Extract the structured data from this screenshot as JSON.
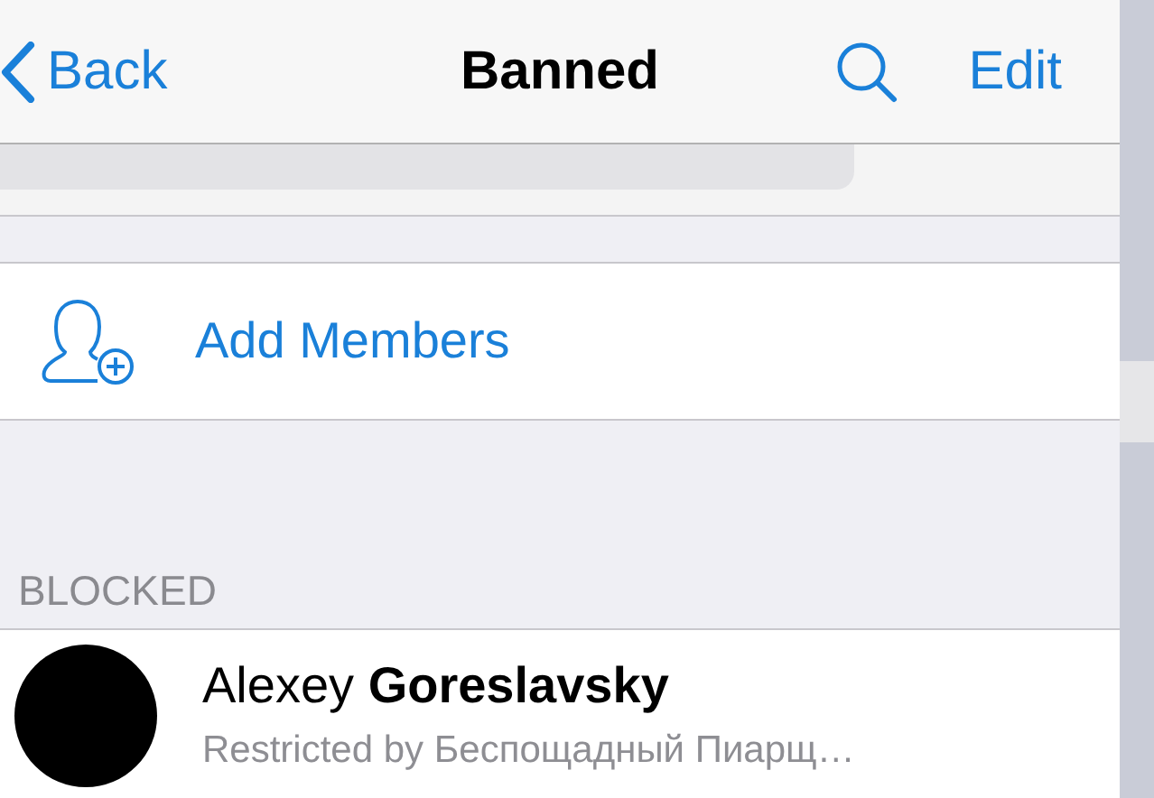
{
  "nav": {
    "back": "Back",
    "title": "Banned",
    "edit": "Edit"
  },
  "add_members": {
    "label": "Add Members"
  },
  "section": {
    "header": "BLOCKED"
  },
  "members": [
    {
      "name": "Alexey **Goreslavsky**",
      "subtitle": "Restricted by Беспощадный Пиарщ…"
    }
  ]
}
